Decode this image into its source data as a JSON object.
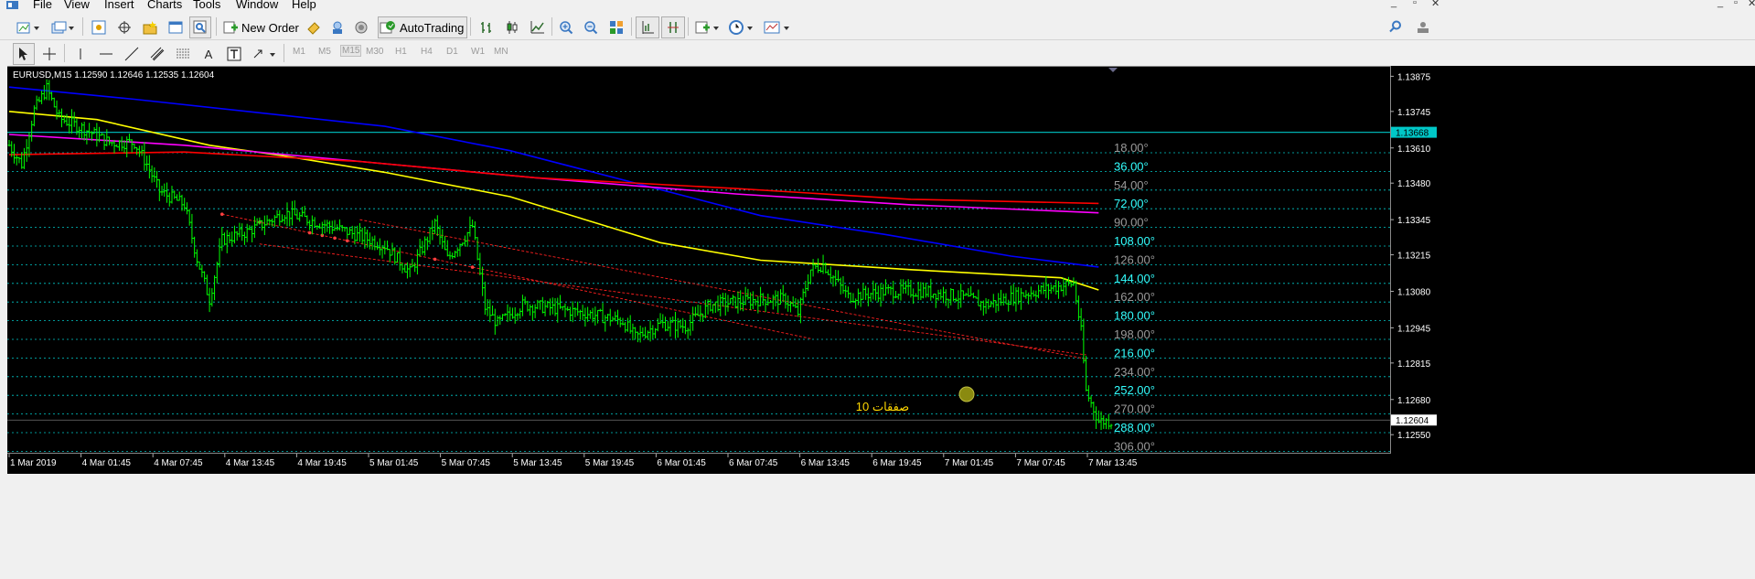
{
  "menu": {
    "items": [
      "File",
      "View",
      "Insert",
      "Charts",
      "Tools",
      "Window",
      "Help"
    ]
  },
  "toolbar": {
    "new_order_label": "New Order",
    "autotrading_label": "AutoTrading"
  },
  "timeframes": [
    "M1",
    "M5",
    "M15",
    "M30",
    "H1",
    "H4",
    "D1",
    "W1",
    "MN"
  ],
  "selected_timeframe": "M15",
  "chart": {
    "header": "EURUSD,M15  1.12590 1.12646 1.12535 1.12604",
    "annotation": "صفقات 10",
    "current_price_label": "1.12604",
    "level_label": "1.13668",
    "colors": {
      "background": "#000000",
      "bars": "#00ff00",
      "ma_yellow": "#ffff00",
      "ma_blue": "#0000ff",
      "ma_magenta": "#ff00ff",
      "ma_red": "#ff0000",
      "levels": "#00c8c8",
      "annotation": "#ffd700"
    }
  },
  "chart_data": {
    "type": "candlestick",
    "title": "EURUSD,M15",
    "price_scale": [
      "1.13875",
      "1.13745",
      "1.13610",
      "1.13480",
      "1.13345",
      "1.13215",
      "1.13080",
      "1.12945",
      "1.12815",
      "1.12680",
      "1.12550"
    ],
    "ylim": [
      1.125,
      1.139
    ],
    "time_labels": [
      "1 Mar 2019",
      "4 Mar 01:45",
      "4 Mar 07:45",
      "4 Mar 13:45",
      "4 Mar 19:45",
      "5 Mar 01:45",
      "5 Mar 07:45",
      "5 Mar 13:45",
      "5 Mar 19:45",
      "6 Mar 01:45",
      "6 Mar 07:45",
      "6 Mar 13:45",
      "6 Mar 19:45",
      "7 Mar 01:45",
      "7 Mar 07:45",
      "7 Mar 13:45"
    ],
    "degree_levels": [
      "18.00°",
      "36.00°",
      "54.00°",
      "72.00°",
      "90.00°",
      "108.00°",
      "126.00°",
      "144.00°",
      "162.00°",
      "180.00°",
      "198.00°",
      "216.00°",
      "234.00°",
      "252.00°",
      "270.00°",
      "288.00°",
      "306.00°"
    ],
    "horizontal_level": 1.13668,
    "last_price": 1.12604,
    "price_path": [
      [
        0,
        1.1362
      ],
      [
        5,
        1.1355
      ],
      [
        10,
        1.1375
      ],
      [
        15,
        1.1383
      ],
      [
        20,
        1.1372
      ],
      [
        30,
        1.1368
      ],
      [
        40,
        1.1363
      ],
      [
        50,
        1.1363
      ],
      [
        55,
        1.1355
      ],
      [
        60,
        1.1345
      ],
      [
        70,
        1.134
      ],
      [
        75,
        1.132
      ],
      [
        80,
        1.1305
      ],
      [
        85,
        1.1327
      ],
      [
        95,
        1.133
      ],
      [
        110,
        1.1337
      ],
      [
        125,
        1.1333
      ],
      [
        135,
        1.133
      ],
      [
        150,
        1.1325
      ],
      [
        160,
        1.1315
      ],
      [
        170,
        1.1333
      ],
      [
        175,
        1.132
      ],
      [
        185,
        1.1332
      ],
      [
        190,
        1.1302
      ],
      [
        195,
        1.1296
      ],
      [
        205,
        1.1303
      ],
      [
        215,
        1.1302
      ],
      [
        230,
        1.13
      ],
      [
        245,
        1.1297
      ],
      [
        250,
        1.1291
      ],
      [
        260,
        1.1296
      ],
      [
        270,
        1.1295
      ],
      [
        280,
        1.1303
      ],
      [
        300,
        1.1305
      ],
      [
        310,
        1.1305
      ],
      [
        315,
        1.13
      ],
      [
        320,
        1.1316
      ],
      [
        325,
        1.1318
      ],
      [
        335,
        1.1306
      ],
      [
        350,
        1.1308
      ],
      [
        365,
        1.1308
      ],
      [
        380,
        1.1306
      ],
      [
        390,
        1.1303
      ],
      [
        405,
        1.1307
      ],
      [
        415,
        1.1309
      ],
      [
        425,
        1.1311
      ],
      [
        428,
        1.1293
      ],
      [
        430,
        1.1271
      ],
      [
        435,
        1.126
      ]
    ],
    "x_range": [
      0,
      440
    ],
    "moving_averages": [
      {
        "color": "#ffff00",
        "points": [
          [
            0,
            1.13745
          ],
          [
            35,
            1.13715
          ],
          [
            80,
            1.1362
          ],
          [
            110,
            1.1358
          ],
          [
            150,
            1.1352
          ],
          [
            200,
            1.1343
          ],
          [
            260,
            1.1326
          ],
          [
            300,
            1.13195
          ],
          [
            360,
            1.1316
          ],
          [
            420,
            1.1313
          ],
          [
            435,
            1.13085
          ]
        ]
      },
      {
        "color": "#0000ff",
        "points": [
          [
            0,
            1.13835
          ],
          [
            50,
            1.1379
          ],
          [
            100,
            1.1374
          ],
          [
            150,
            1.1369
          ],
          [
            200,
            1.136
          ],
          [
            250,
            1.1348
          ],
          [
            300,
            1.1336
          ],
          [
            350,
            1.1329
          ],
          [
            400,
            1.1321
          ],
          [
            435,
            1.1317
          ]
        ]
      },
      {
        "color": "#ff00ff",
        "points": [
          [
            0,
            1.1366
          ],
          [
            70,
            1.1362
          ],
          [
            140,
            1.1356
          ],
          [
            210,
            1.135
          ],
          [
            290,
            1.1344
          ],
          [
            360,
            1.134
          ],
          [
            435,
            1.1337
          ]
        ]
      },
      {
        "color": "#ff0000",
        "points": [
          [
            0,
            1.13585
          ],
          [
            70,
            1.13595
          ],
          [
            140,
            1.1356
          ],
          [
            210,
            1.135
          ],
          [
            290,
            1.1346
          ],
          [
            360,
            1.1342
          ],
          [
            435,
            1.13405
          ]
        ]
      }
    ],
    "trendlines": [
      {
        "from": [
          85,
          1.13365
        ],
        "to": [
          320,
          1.12905
        ]
      },
      {
        "from": [
          140,
          1.13345
        ],
        "to": [
          430,
          1.1283
        ]
      },
      {
        "from": [
          100,
          1.13255
        ],
        "to": [
          430,
          1.12845
        ]
      }
    ]
  }
}
